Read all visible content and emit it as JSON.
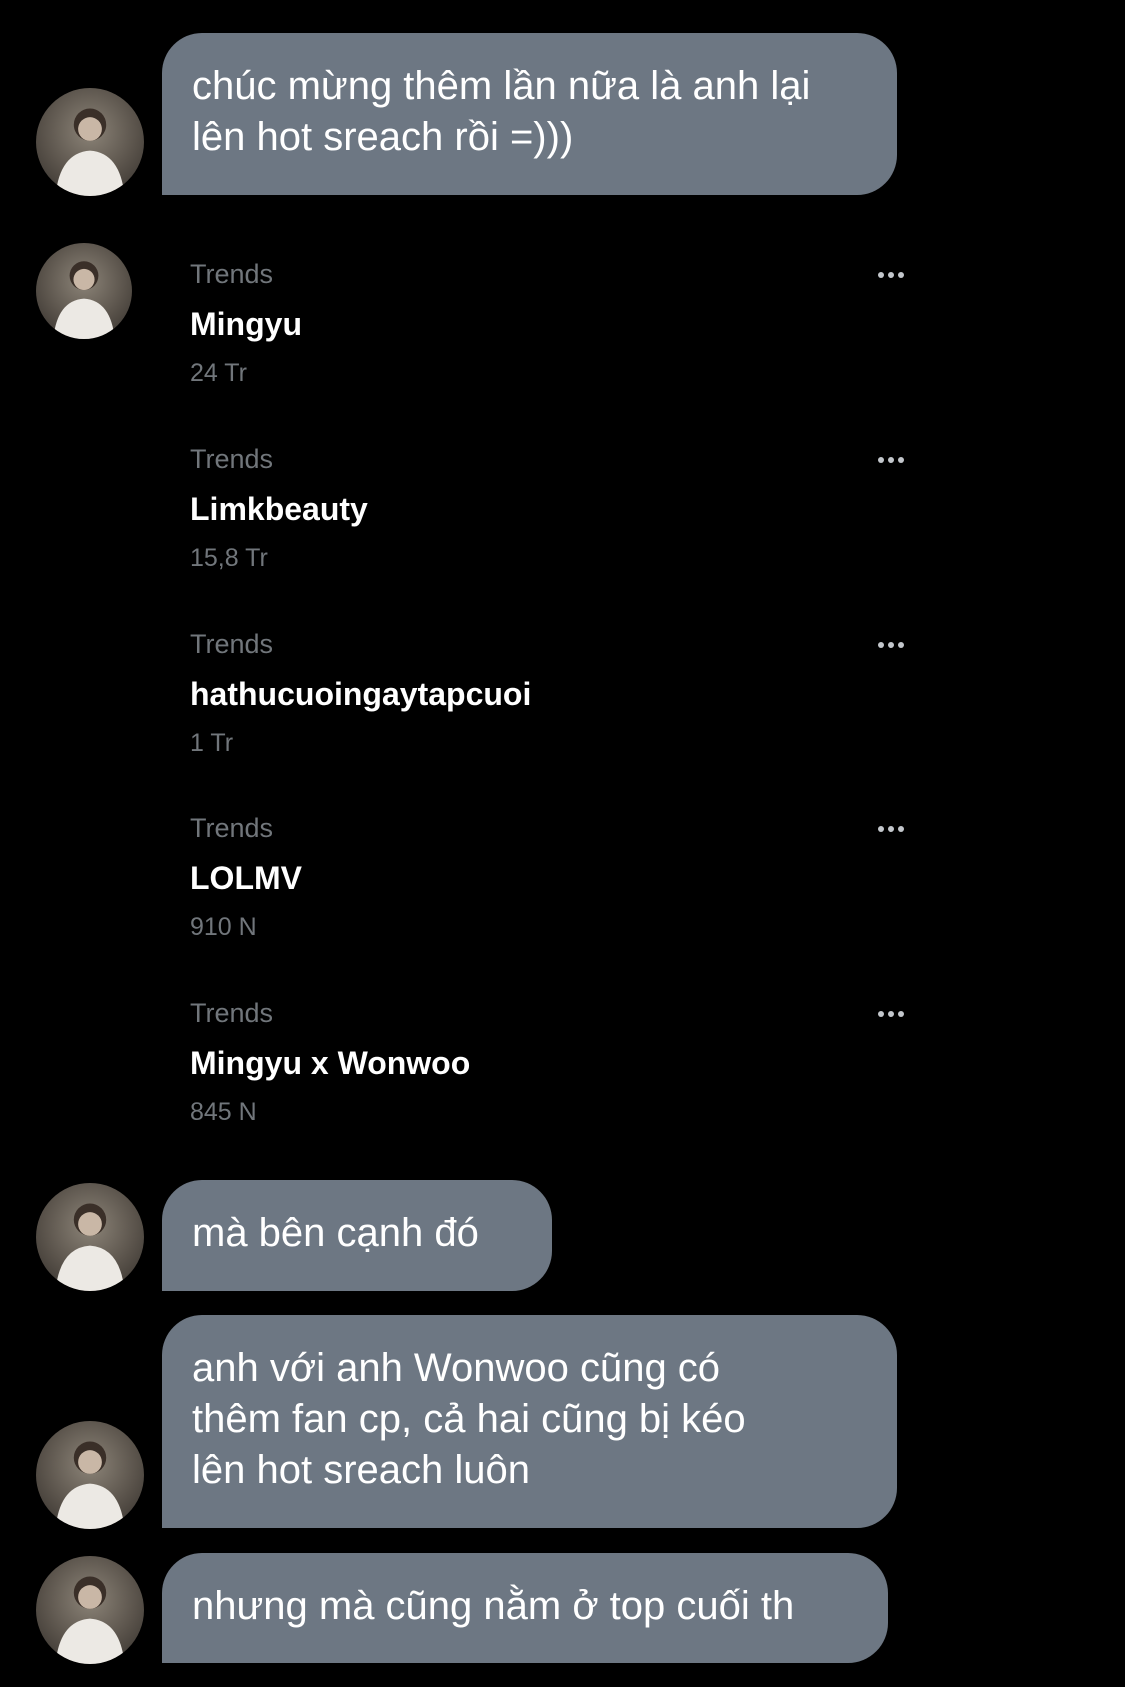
{
  "messages": [
    {
      "text": "chúc mừng thêm lần nữa là anh lại\nlên hot sreach rồi =)))"
    },
    {
      "text": "mà bên cạnh đó"
    },
    {
      "text": "anh với anh Wonwoo cũng có\nthêm fan cp, cả hai cũng bị kéo\nlên hot sreach luôn"
    },
    {
      "text": "nhưng mà cũng nằm ở top cuối th"
    }
  ],
  "trends": [
    {
      "category": "Trends",
      "name": "Mingyu",
      "count": "24 Tr"
    },
    {
      "category": "Trends",
      "name": "Limkbeauty",
      "count": "15,8 Tr"
    },
    {
      "category": "Trends",
      "name": "hathucuoingaytapcuoi",
      "count": "1 Tr"
    },
    {
      "category": "Trends",
      "name": "LOLMV",
      "count": "910 N"
    },
    {
      "category": "Trends",
      "name": "Mingyu x Wonwoo",
      "count": "845 N"
    }
  ],
  "icons": {
    "avatar": "profile-photo",
    "more": "more-options-icon"
  },
  "colors": {
    "background": "#000000",
    "bubble": "#6d7783",
    "secondary_text": "#71767b"
  }
}
